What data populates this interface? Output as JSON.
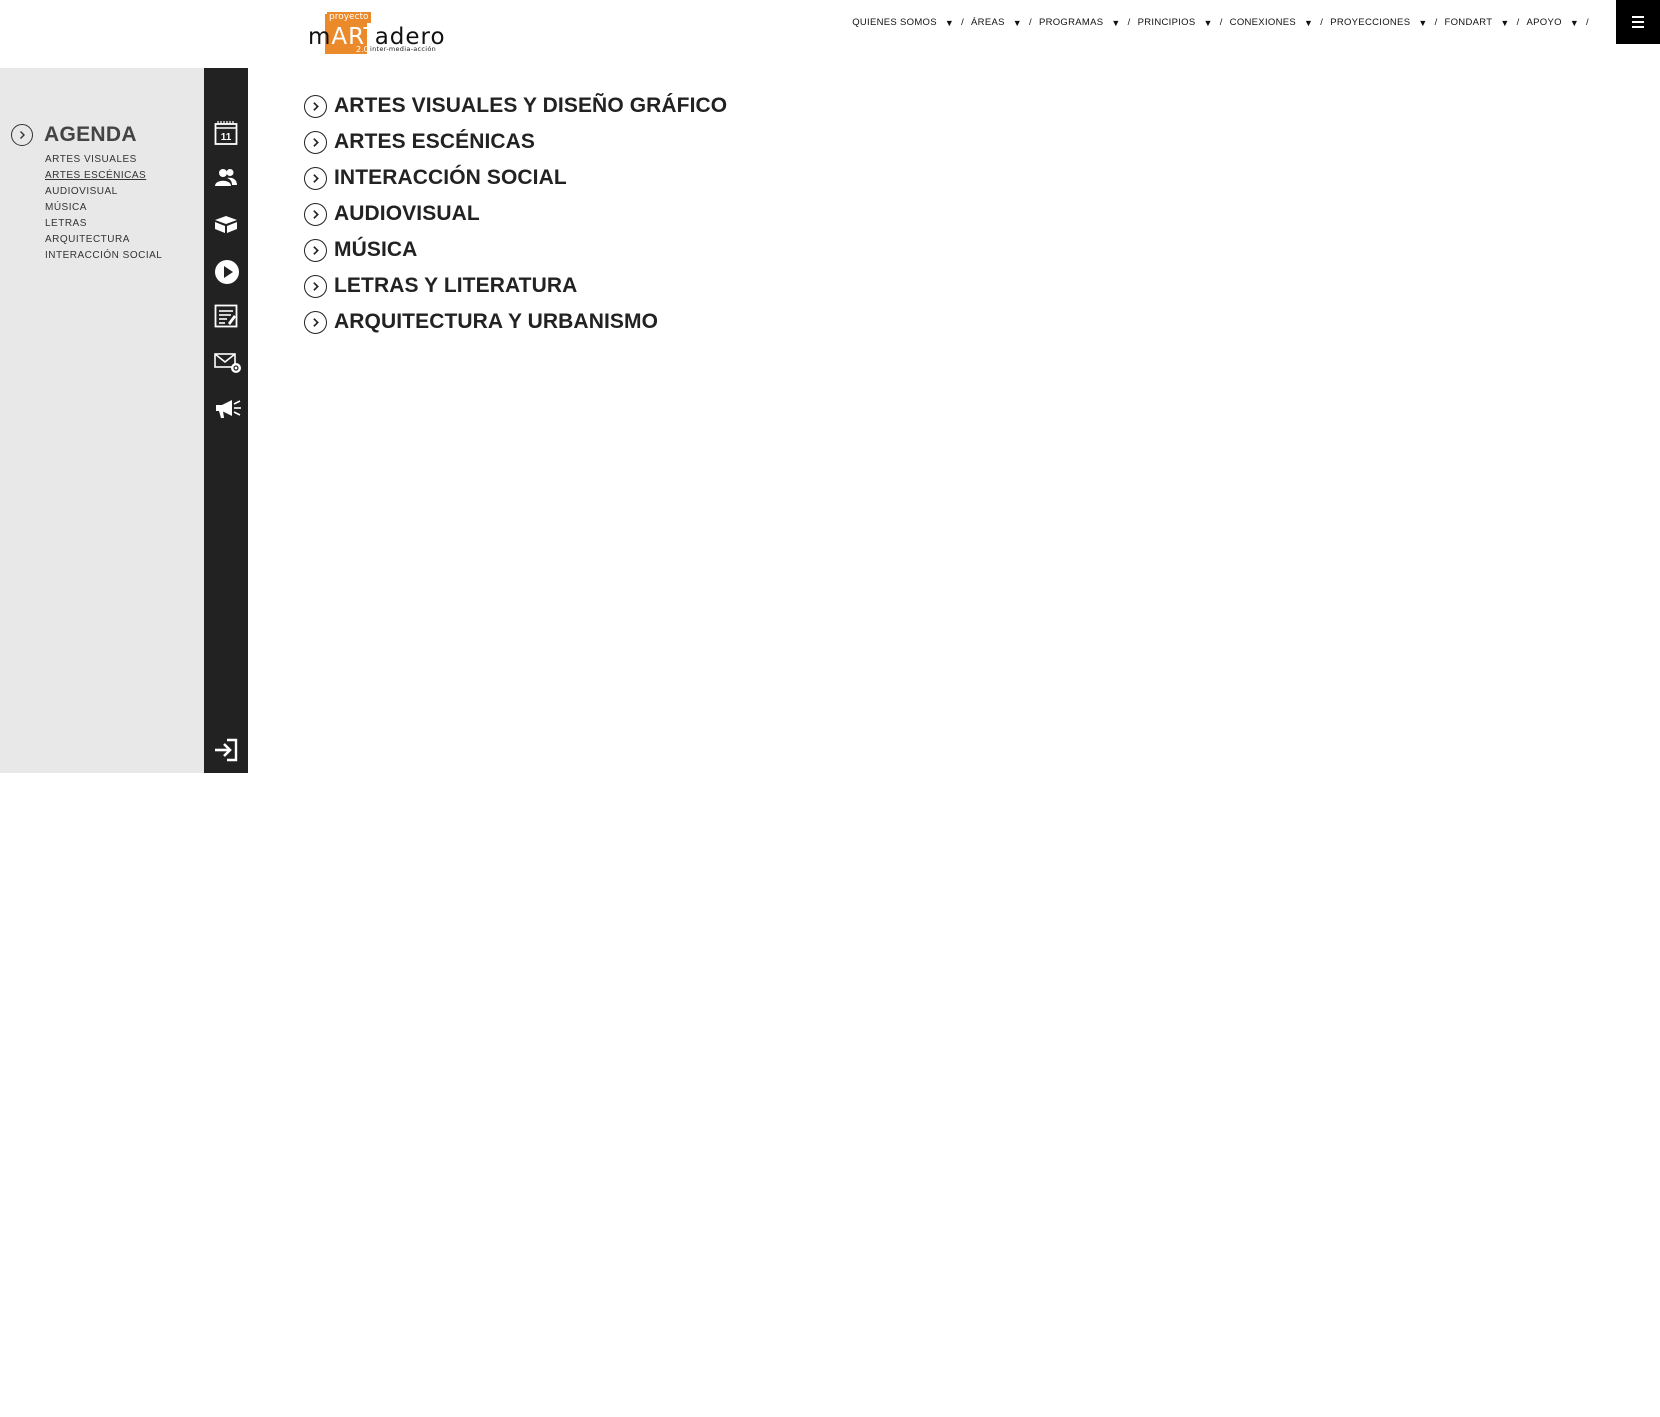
{
  "brand": {
    "logo_top": "proyecto",
    "logo_pre": "m",
    "logo_art": "ART",
    "logo_post": "adero",
    "logo_version": "2.0",
    "logo_tagline": "inter-media-acción",
    "accent_color": "#ea8a2b"
  },
  "topnav": {
    "items": [
      {
        "label": "QUIENES SOMOS"
      },
      {
        "label": "ÁREAS"
      },
      {
        "label": "PROGRAMAS"
      },
      {
        "label": "PRINCIPIOS"
      },
      {
        "label": "CONEXIONES"
      },
      {
        "label": "PROYECCIONES"
      },
      {
        "label": "FONDART"
      },
      {
        "label": "APOYO"
      }
    ],
    "separator": "/",
    "caret": "▼"
  },
  "menu_toggle": {
    "icon": "hamburger-icon"
  },
  "sidebar": {
    "title": "AGENDA",
    "items": [
      {
        "label": "ARTES VISUALES"
      },
      {
        "label": "ARTES ESCÉNICAS"
      },
      {
        "label": "AUDIOVISUAL"
      },
      {
        "label": "MÚSICA"
      },
      {
        "label": "LETRAS"
      },
      {
        "label": "ARQUITECTURA"
      },
      {
        "label": "INTERACCIÓN SOCIAL"
      }
    ],
    "active_index": 1
  },
  "rail": {
    "calendar_day": "11",
    "icons": [
      "calendar-icon",
      "people-icon",
      "box-icon",
      "play-icon",
      "document-icon",
      "mail-icon",
      "megaphone-icon",
      "login-icon"
    ]
  },
  "areas": {
    "items": [
      {
        "label": "ARTES VISUALES Y DISEÑO GRÁFICO"
      },
      {
        "label": "ARTES ESCÉNICAS"
      },
      {
        "label": "INTERACCIÓN SOCIAL"
      },
      {
        "label": "AUDIOVISUAL"
      },
      {
        "label": "MÚSICA"
      },
      {
        "label": "LETRAS Y LITERATURA"
      },
      {
        "label": "ARQUITECTURA Y URBANISMO"
      }
    ]
  }
}
